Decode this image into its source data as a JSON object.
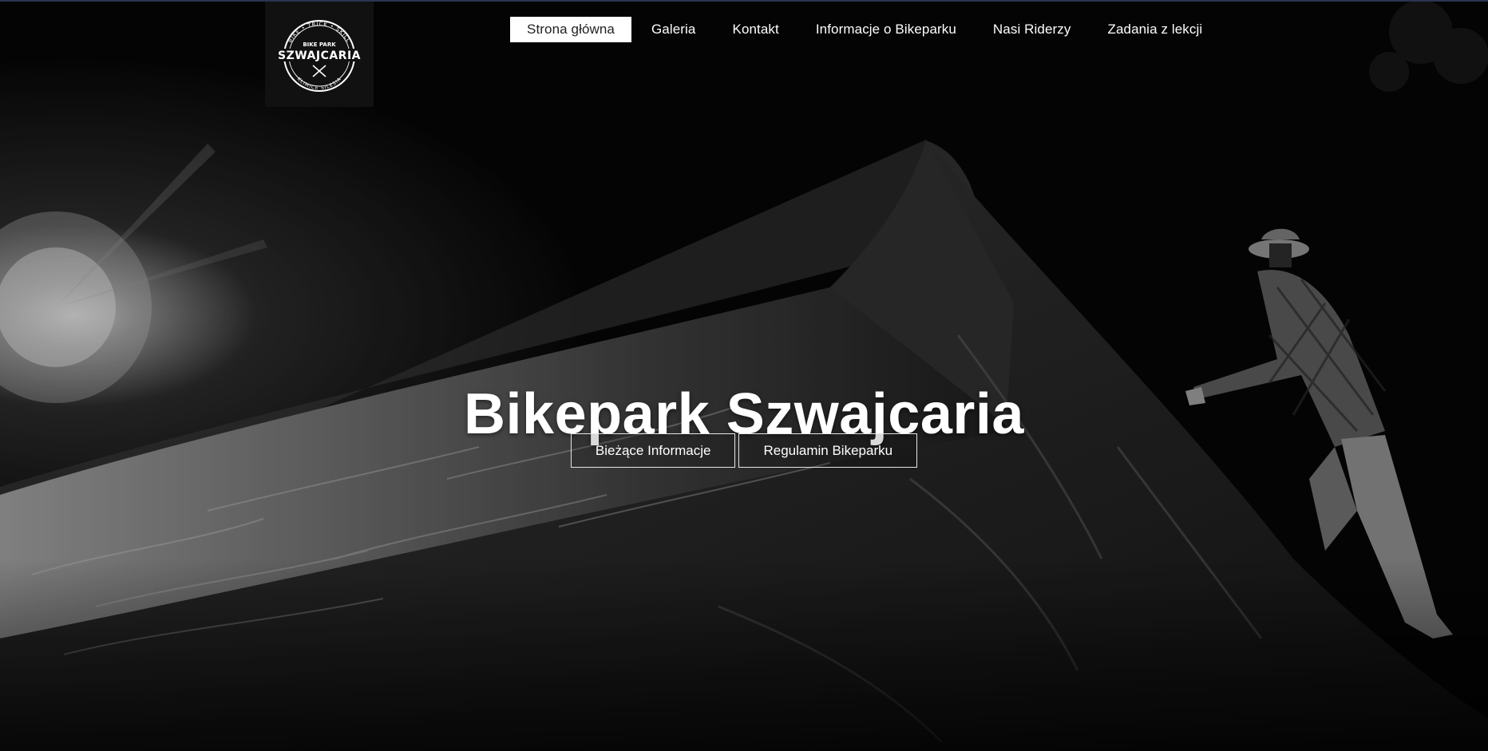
{
  "logo": {
    "top_arc": "BIKE • TRICK • SKILL",
    "small_label": "BIKE PARK",
    "name": "SZWAJCARIA",
    "bottom_arc": "KLIMICE SILESIA"
  },
  "nav": {
    "items": [
      {
        "label": "Strona główna",
        "active": true
      },
      {
        "label": "Galeria",
        "active": false
      },
      {
        "label": "Kontakt",
        "active": false
      },
      {
        "label": "Informacje o Bikeparku",
        "active": false
      },
      {
        "label": "Nasi Riderzy",
        "active": false
      },
      {
        "label": "Zadania z lekcji",
        "active": false
      }
    ]
  },
  "hero": {
    "title": "Bikepark Szwajcaria",
    "buttons": {
      "current_info": "Bieżące Informacje",
      "rules": "Regulamin Bikeparku"
    }
  },
  "colors": {
    "accent_active_bg": "#ffffff",
    "text": "#ffffff",
    "background": "#050505"
  }
}
